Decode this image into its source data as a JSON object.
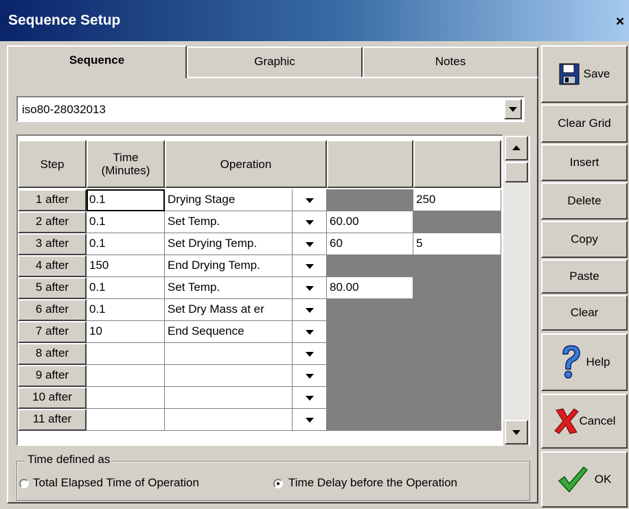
{
  "window": {
    "title": "Sequence Setup",
    "close_glyph": "×"
  },
  "tabs": [
    {
      "label": "Sequence",
      "active": true
    },
    {
      "label": "Graphic",
      "active": false
    },
    {
      "label": "Notes",
      "active": false
    }
  ],
  "sequence_select": {
    "value": "iso80-28032013"
  },
  "grid": {
    "headers": {
      "step": "Step",
      "time_line1": "Time",
      "time_line2": "(Minutes)",
      "operation": "Operation",
      "col4": "",
      "col5": ""
    },
    "rows": [
      {
        "step": "1 after",
        "time": "0.1",
        "operation": "Drying Stage",
        "col4": "",
        "col5": "250"
      },
      {
        "step": "2 after",
        "time": "0.1",
        "operation": "Set Temp.",
        "col4": "60.00",
        "col5": ""
      },
      {
        "step": "3 after",
        "time": "0.1",
        "operation": "Set Drying Temp.",
        "col4": " 60",
        "col5": "5"
      },
      {
        "step": "4 after",
        "time": "150",
        "operation": "End Drying Temp.",
        "col4": "",
        "col5": ""
      },
      {
        "step": "5 after",
        "time": "0.1",
        "operation": "Set Temp.",
        "col4": "80.00",
        "col5": ""
      },
      {
        "step": "6 after",
        "time": "0.1",
        "operation": "Set Dry Mass at er",
        "col4": "",
        "col5": ""
      },
      {
        "step": "7 after",
        "time": "10",
        "operation": "End Sequence",
        "col4": "",
        "col5": ""
      },
      {
        "step": "8 after",
        "time": "",
        "operation": "",
        "col4": "",
        "col5": ""
      },
      {
        "step": "9 after",
        "time": "",
        "operation": "",
        "col4": "",
        "col5": ""
      },
      {
        "step": "10 after",
        "time": "",
        "operation": "",
        "col4": "",
        "col5": ""
      },
      {
        "step": "11 after",
        "time": "",
        "operation": "",
        "col4": "",
        "col5": ""
      }
    ]
  },
  "time_defined": {
    "title": "Time defined as",
    "options": [
      {
        "label": "Total Elapsed Time of Operation",
        "selected": false
      },
      {
        "label": "Time Delay before the Operation",
        "selected": true
      }
    ]
  },
  "side_buttons": {
    "save": "Save",
    "clear_grid": "Clear Grid",
    "insert": "Insert",
    "delete": "Delete",
    "copy": "Copy",
    "paste": "Paste",
    "clear": "Clear",
    "help": "Help",
    "cancel": "Cancel",
    "ok": "OK"
  },
  "icons": {
    "save": "floppy-disk-icon",
    "help": "question-mark-icon",
    "cancel": "red-x-icon",
    "ok": "green-checkmark-icon"
  },
  "colors": {
    "title_start": "#0a246a",
    "title_end": "#a6caf0",
    "face": "#d4d0c8",
    "disabled_cell": "#808080"
  }
}
